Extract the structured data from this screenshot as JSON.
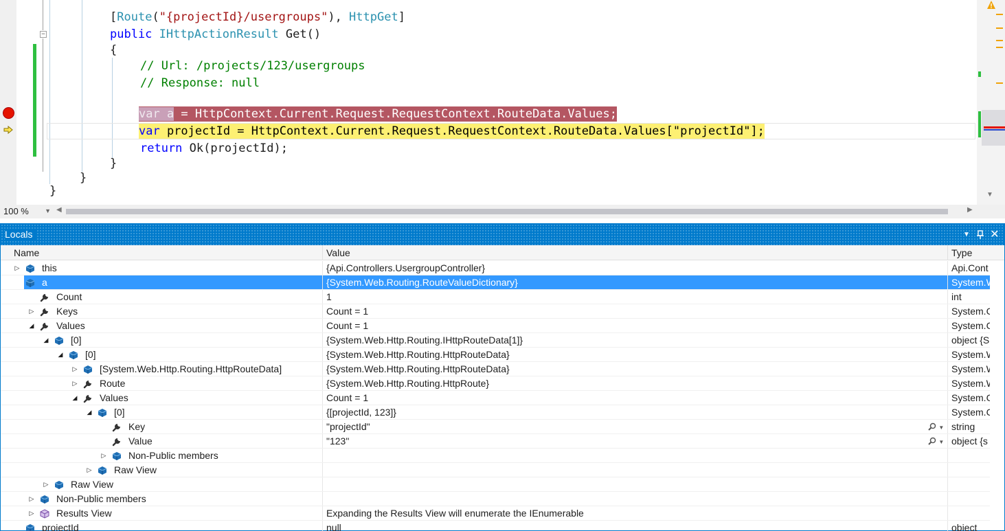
{
  "editor": {
    "lines": {
      "attr": {
        "open": "[",
        "route": "Route",
        "p1": "(",
        "str": "\"{projectId}/usergroups\"",
        "p2": "), ",
        "httpget": "HttpGet",
        "close": "]"
      },
      "sig": {
        "kw": "public",
        "sp": " ",
        "type": "IHttpActionResult",
        "rest": " Get()"
      },
      "open_brace": "{",
      "comment1": "// Url: /projects/123/usergroups",
      "comment2": "// Response: null",
      "bp": {
        "sel": "var a",
        "rest": " = HttpContext.Current.Request.RequestContext.RouteData.Values;"
      },
      "cur": {
        "kw": "var",
        "rest": " projectId = HttpContext.Current.Request.RequestContext.RouteData.Values[\"projectId\"];"
      },
      "ret": {
        "kw": "return",
        "rest": " Ok(projectId);"
      },
      "close1": "}",
      "close2": "}",
      "close3": "}"
    },
    "zoom": "100 %"
  },
  "locals": {
    "title": "Locals",
    "columns": {
      "name": "Name",
      "value": "Value",
      "type": "Type"
    },
    "rows": [
      {
        "name": "this",
        "value": "{Api.Controllers.UsergroupController}",
        "type": "Api.Cont"
      },
      {
        "name": "a",
        "value": "{System.Web.Routing.RouteValueDictionary}",
        "type": "System.W"
      },
      {
        "name": "Count",
        "value": "1",
        "type": "int"
      },
      {
        "name": "Keys",
        "value": "Count = 1",
        "type": "System.C"
      },
      {
        "name": "Values",
        "value": "Count = 1",
        "type": "System.C"
      },
      {
        "name": "[0]",
        "value": "{System.Web.Http.Routing.IHttpRouteData[1]}",
        "type": "object {S"
      },
      {
        "name": "[0]",
        "value": "{System.Web.Http.Routing.HttpRouteData}",
        "type": "System.W"
      },
      {
        "name": "[System.Web.Http.Routing.HttpRouteData]",
        "value": "{System.Web.Http.Routing.HttpRouteData}",
        "type": "System.W"
      },
      {
        "name": "Route",
        "value": "{System.Web.Http.Routing.HttpRoute}",
        "type": "System.W"
      },
      {
        "name": "Values",
        "value": "Count = 1",
        "type": "System.C"
      },
      {
        "name": "[0]",
        "value": "{[projectId, 123]}",
        "type": "System.C"
      },
      {
        "name": "Key",
        "value": "\"projectId\"",
        "type": "string"
      },
      {
        "name": "Value",
        "value": "\"123\"",
        "type": "object {s"
      },
      {
        "name": "Non-Public members",
        "value": "",
        "type": ""
      },
      {
        "name": "Raw View",
        "value": "",
        "type": ""
      },
      {
        "name": "Raw View",
        "value": "",
        "type": ""
      },
      {
        "name": "Non-Public members",
        "value": "",
        "type": ""
      },
      {
        "name": "Results View",
        "value": "Expanding the Results View will enumerate the IEnumerable",
        "type": ""
      },
      {
        "name": "projectId",
        "value": "null",
        "type": "object"
      }
    ]
  }
}
